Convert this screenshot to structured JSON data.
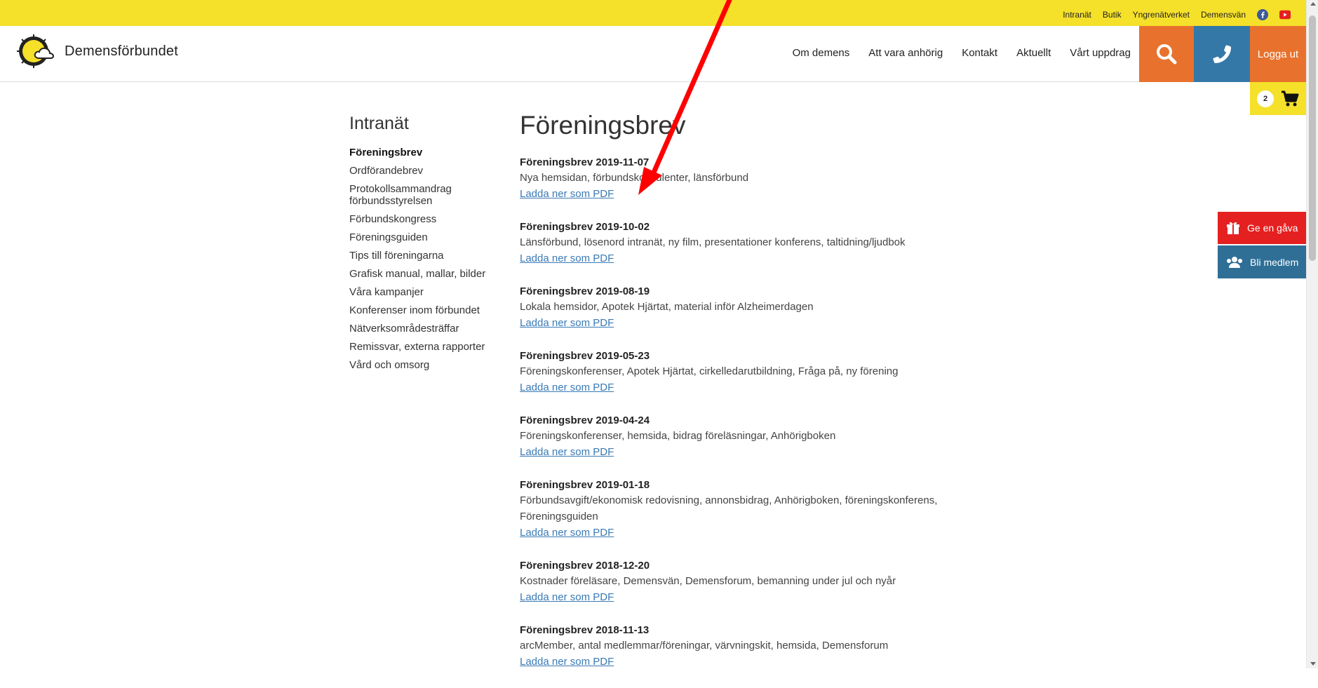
{
  "topbar": {
    "links": [
      "Intranät",
      "Butik",
      "Yngrenätverket",
      "Demensvän"
    ]
  },
  "header": {
    "brand": "Demensförbundet",
    "nav": [
      "Om demens",
      "Att vara anhörig",
      "Kontakt",
      "Aktuellt",
      "Vårt uppdrag"
    ],
    "logout": "Logga ut",
    "cart_count": "2"
  },
  "side_ctas": {
    "gift": "Ge en gåva",
    "member": "Bli medlem"
  },
  "sidebar": {
    "title": "Intranät",
    "items": [
      "Föreningsbrev",
      "Ordförandebrev",
      "Protokollsammandrag förbundsstyrelsen",
      "Förbundskongress",
      "Föreningsguiden",
      "Tips till föreningarna",
      "Grafisk manual, mallar, bilder",
      "Våra kampanjer",
      "Konferenser inom förbundet",
      "Nätverksområdesträffar",
      "Remissvar, externa rapporter",
      "Vård och omsorg"
    ]
  },
  "content": {
    "title": "Föreningsbrev",
    "entries": [
      {
        "title": "Föreningsbrev 2019-11-07",
        "desc": "Nya hemsidan, förbundskonsulenter, länsförbund",
        "link": "Ladda ner som PDF"
      },
      {
        "title": "Föreningsbrev 2019-10-02",
        "desc": "Länsförbund, lösenord intranät, ny film, presentationer konferens, taltidning/ljudbok",
        "link": "Ladda ner som PDF"
      },
      {
        "title": "Föreningsbrev 2019-08-19",
        "desc": "Lokala hemsidor, Apotek Hjärtat, material inför Alzheimerdagen",
        "link": "Ladda ner som PDF"
      },
      {
        "title": "Föreningsbrev 2019-05-23",
        "desc": "Föreningskonferenser, Apotek Hjärtat, cirkelledarutbildning, Fråga på, ny förening",
        "link": "Ladda ner som PDF"
      },
      {
        "title": "Föreningsbrev 2019-04-24",
        "desc": "Föreningskonferenser, hemsida, bidrag föreläsningar, Anhörigboken",
        "link": "Ladda ner som PDF"
      },
      {
        "title": "Föreningsbrev 2019-01-18",
        "desc": "Förbundsavgift/ekonomisk redovisning, annonsbidrag, Anhörigboken, föreningskonferens, Föreningsguiden",
        "link": "Ladda ner som PDF"
      },
      {
        "title": "Föreningsbrev 2018-12-20",
        "desc": "Kostnader föreläsare, Demensvän, Demensforum, bemanning under jul och nyår",
        "link": "Ladda ner som PDF"
      },
      {
        "title": "Föreningsbrev 2018-11-13",
        "desc": "arcMember, antal medlemmar/föreningar, värvningskit, hemsida, Demensforum",
        "link": "Ladda ner som PDF"
      }
    ]
  },
  "colors": {
    "yellow": "#f5e02a",
    "orange": "#e8722d",
    "blue": "#3478a8",
    "red": "#e52020",
    "link": "#3a7ab5",
    "annotation_arrow": "#ff0000"
  },
  "icons": [
    "facebook-icon",
    "youtube-icon",
    "search-icon",
    "phone-icon",
    "cart-icon",
    "gift-icon",
    "users-icon"
  ]
}
